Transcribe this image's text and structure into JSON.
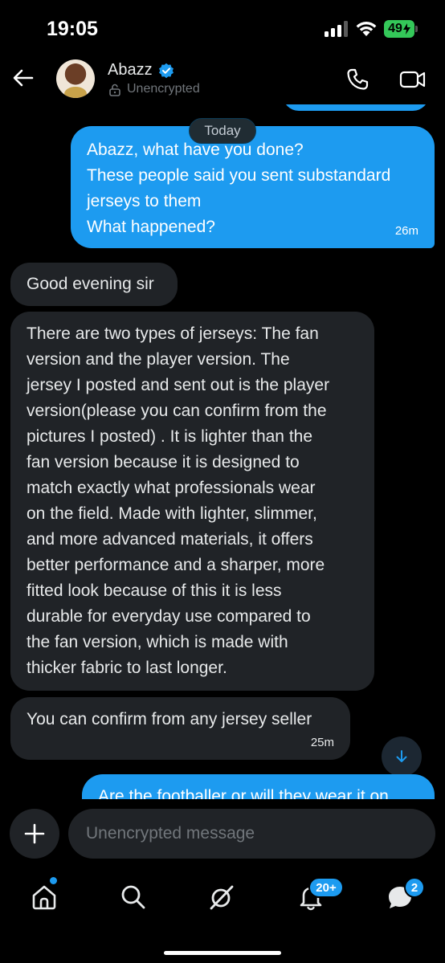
{
  "status_bar": {
    "time": "19:05",
    "battery": "49"
  },
  "header": {
    "name": "Abazz",
    "encryption_status": "Unencrypted"
  },
  "chat": {
    "date_separator": "Today",
    "messages": [
      {
        "direction": "out",
        "lines": [
          "Abazz, what have you done?",
          "These people said you sent substandard",
          "jerseys to them",
          "What happened?"
        ],
        "time": "26m"
      },
      {
        "direction": "in",
        "text": "Good evening sir"
      },
      {
        "direction": "in",
        "lines": [
          "There are two types of jerseys: The fan",
          "version and the player version. The",
          "jersey I posted and sent out is the player",
          "version(please you can confirm from the",
          "pictures I posted) . It is lighter than the",
          "fan version because it is designed to",
          "match exactly what professionals wear",
          "on the field. Made with lighter, slimmer,",
          "and more advanced materials, it offers",
          "better performance and a sharper, more",
          "fitted look because of this it is less",
          "durable for everyday use compared to",
          "the fan version, which is made with",
          "thicker fabric to last longer."
        ]
      },
      {
        "direction": "in",
        "text": "You can confirm from any jersey seller",
        "time": "25m"
      },
      {
        "direction": "out",
        "text": "Are the footballer or will they wear it on"
      }
    ]
  },
  "composer": {
    "placeholder": "Unencrypted message"
  },
  "nav": {
    "notifications_badge": "20+",
    "messages_badge": "2"
  },
  "colors": {
    "accent": "#1d9bf0",
    "incoming_bubble": "#202327",
    "background": "#000000"
  }
}
